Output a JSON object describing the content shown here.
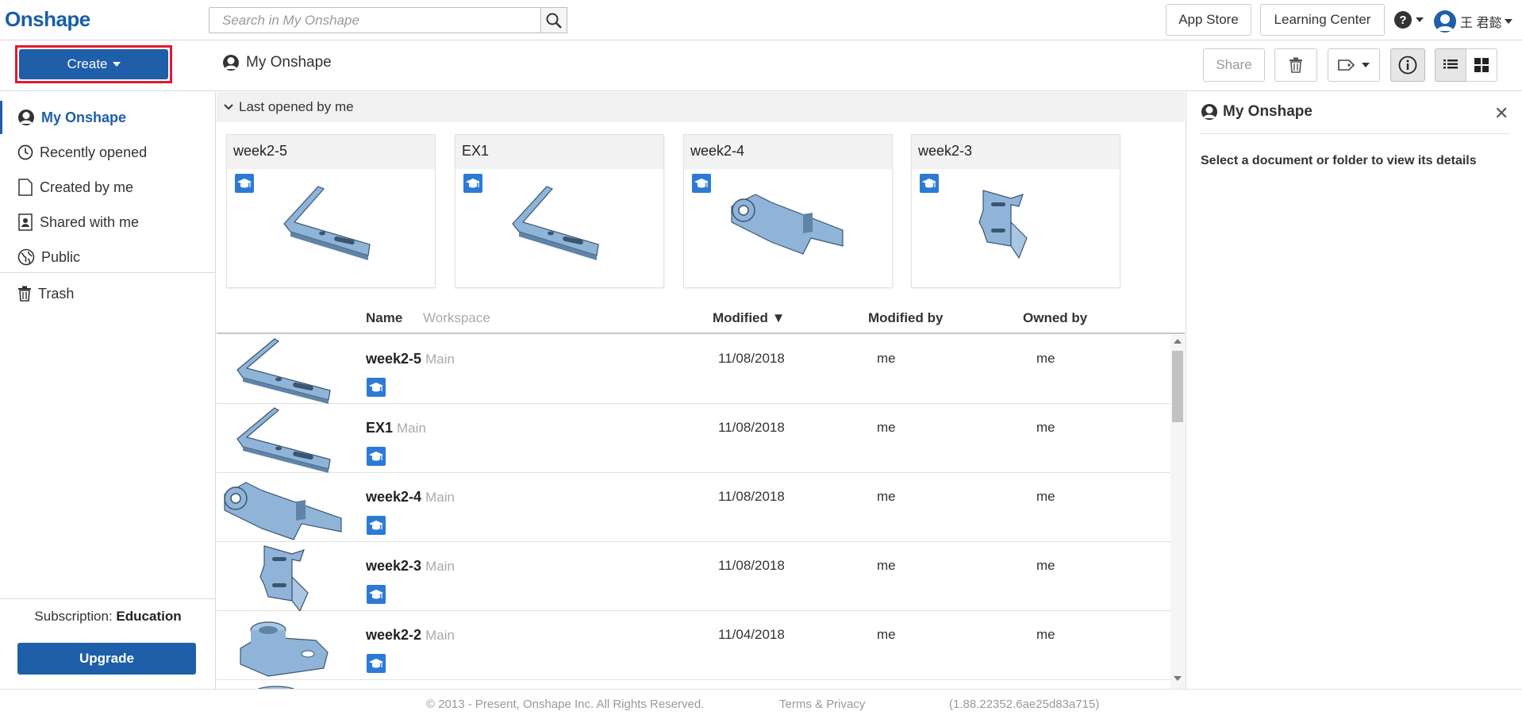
{
  "app": {
    "logo": "Onshape"
  },
  "search": {
    "placeholder": "Search in My Onshape"
  },
  "topbar": {
    "app_store": "App Store",
    "learning_center": "Learning Center",
    "user_name": "王 君懿"
  },
  "toolbar": {
    "create_label": "Create",
    "breadcrumb": "My Onshape",
    "share_label": "Share"
  },
  "sidebar": {
    "items": [
      {
        "label": "My Onshape",
        "icon": "person-icon",
        "active": true
      },
      {
        "label": "Recently opened",
        "icon": "clock-icon"
      },
      {
        "label": "Created by me",
        "icon": "document-icon"
      },
      {
        "label": "Shared with me",
        "icon": "shared-user-icon"
      },
      {
        "label": "Public",
        "icon": "globe-icon"
      },
      {
        "label": "Trash",
        "icon": "trash-icon"
      }
    ],
    "subscription_label": "Subscription:",
    "subscription_value": "Education",
    "upgrade_label": "Upgrade"
  },
  "recent": {
    "header": "Last opened by me",
    "cards": [
      {
        "title": "week2-5",
        "thumb": "bracket"
      },
      {
        "title": "EX1",
        "thumb": "bracket"
      },
      {
        "title": "week2-4",
        "thumb": "hinge"
      },
      {
        "title": "week2-3",
        "thumb": "clip"
      }
    ]
  },
  "columns": {
    "name": "Name",
    "workspace": "Workspace",
    "modified": "Modified ▼",
    "modified_by": "Modified by",
    "owned_by": "Owned by"
  },
  "rows": [
    {
      "name": "week2-5",
      "workspace": "Main",
      "modified": "11/08/2018",
      "modified_by": "me",
      "owned_by": "me",
      "thumb": "bracket"
    },
    {
      "name": "EX1",
      "workspace": "Main",
      "modified": "11/08/2018",
      "modified_by": "me",
      "owned_by": "me",
      "thumb": "bracket"
    },
    {
      "name": "week2-4",
      "workspace": "Main",
      "modified": "11/08/2018",
      "modified_by": "me",
      "owned_by": "me",
      "thumb": "hinge"
    },
    {
      "name": "week2-3",
      "workspace": "Main",
      "modified": "11/08/2018",
      "modified_by": "me",
      "owned_by": "me",
      "thumb": "clip"
    },
    {
      "name": "week2-2",
      "workspace": "Main",
      "modified": "11/04/2018",
      "modified_by": "me",
      "owned_by": "me",
      "thumb": "flange"
    }
  ],
  "details": {
    "title": "My Onshape",
    "message": "Select a document or folder to view its details"
  },
  "footer": {
    "copyright": "© 2013 - Present, Onshape Inc. All Rights Reserved.",
    "terms": "Terms & Privacy",
    "version": "(1.88.22352.6ae25d83a715)"
  },
  "colors": {
    "brand_blue": "#1f5ea9",
    "highlight_red": "#e0192e",
    "education_badge": "#2d7ad6",
    "part_blue": "#8fb4d8"
  }
}
